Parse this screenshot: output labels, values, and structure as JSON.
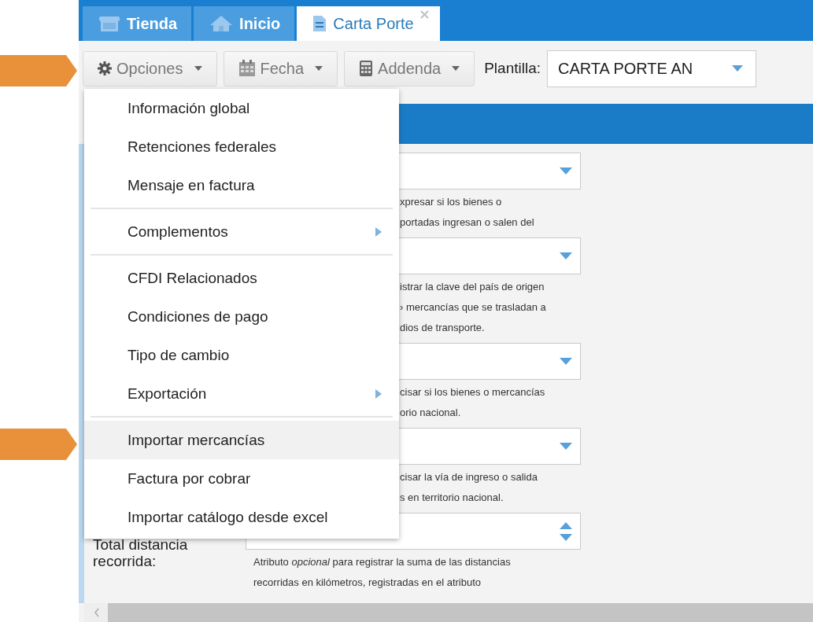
{
  "tabs": [
    {
      "label": "Tienda",
      "kind": "store",
      "selected": false,
      "closable": false
    },
    {
      "label": "Inicio",
      "kind": "home",
      "selected": false,
      "closable": false
    },
    {
      "label": "Carta Porte",
      "kind": "document",
      "selected": true,
      "closable": true
    }
  ],
  "toolbar": {
    "buttons": [
      {
        "label": "Opciones",
        "kind": "options"
      },
      {
        "label": "Fecha",
        "kind": "date"
      },
      {
        "label": "Addenda",
        "kind": "addenda"
      }
    ],
    "template": {
      "label": "Plantilla:",
      "value": "CARTA PORTE AN"
    }
  },
  "menu": {
    "sections": [
      [
        {
          "label": "Información global",
          "submenu": false,
          "selected": false
        },
        {
          "label": "Retenciones federales",
          "submenu": false,
          "selected": false
        },
        {
          "label": "Mensaje en factura",
          "submenu": false,
          "selected": false
        }
      ],
      [
        {
          "label": "Complementos",
          "submenu": true,
          "selected": false
        }
      ],
      [
        {
          "label": "CFDI Relacionados",
          "submenu": false,
          "selected": false
        },
        {
          "label": "Condiciones de pago",
          "submenu": false,
          "selected": false
        },
        {
          "label": "Tipo de cambio",
          "submenu": false,
          "selected": false
        },
        {
          "label": "Exportación",
          "submenu": true,
          "selected": false
        }
      ],
      [
        {
          "label": "Importar mercancías",
          "submenu": false,
          "selected": true
        },
        {
          "label": "Factura por cobrar",
          "submenu": false,
          "selected": false
        },
        {
          "label": "Importar catálogo desde excel",
          "submenu": false,
          "selected": false
        }
      ]
    ]
  },
  "form": {
    "rows": [
      {
        "kind": "select",
        "hint": [
          "xpresar si los bienes o",
          "portadas ingresan o salen del"
        ]
      },
      {
        "kind": "select",
        "hint": [
          "istrar la clave del país de origen",
          "› mercancías que se trasladan a",
          "dios de transporte."
        ]
      },
      {
        "kind": "select",
        "hint": [
          "cisar si los bienes o mercancías",
          "orio nacional."
        ]
      },
      {
        "kind": "select",
        "hint": [
          "cisar la vía de ingreso o salida",
          "s en territorio nacional."
        ]
      },
      {
        "kind": "number",
        "label": "Total distancia recorrida:",
        "hint": [
          "Atributo *opcional* para registrar la suma de las distancias",
          "recorridas en kilómetros, registradas en el atributo"
        ]
      }
    ]
  },
  "annotations": [
    {
      "kind": "arrow"
    },
    {
      "kind": "arrow"
    }
  ]
}
